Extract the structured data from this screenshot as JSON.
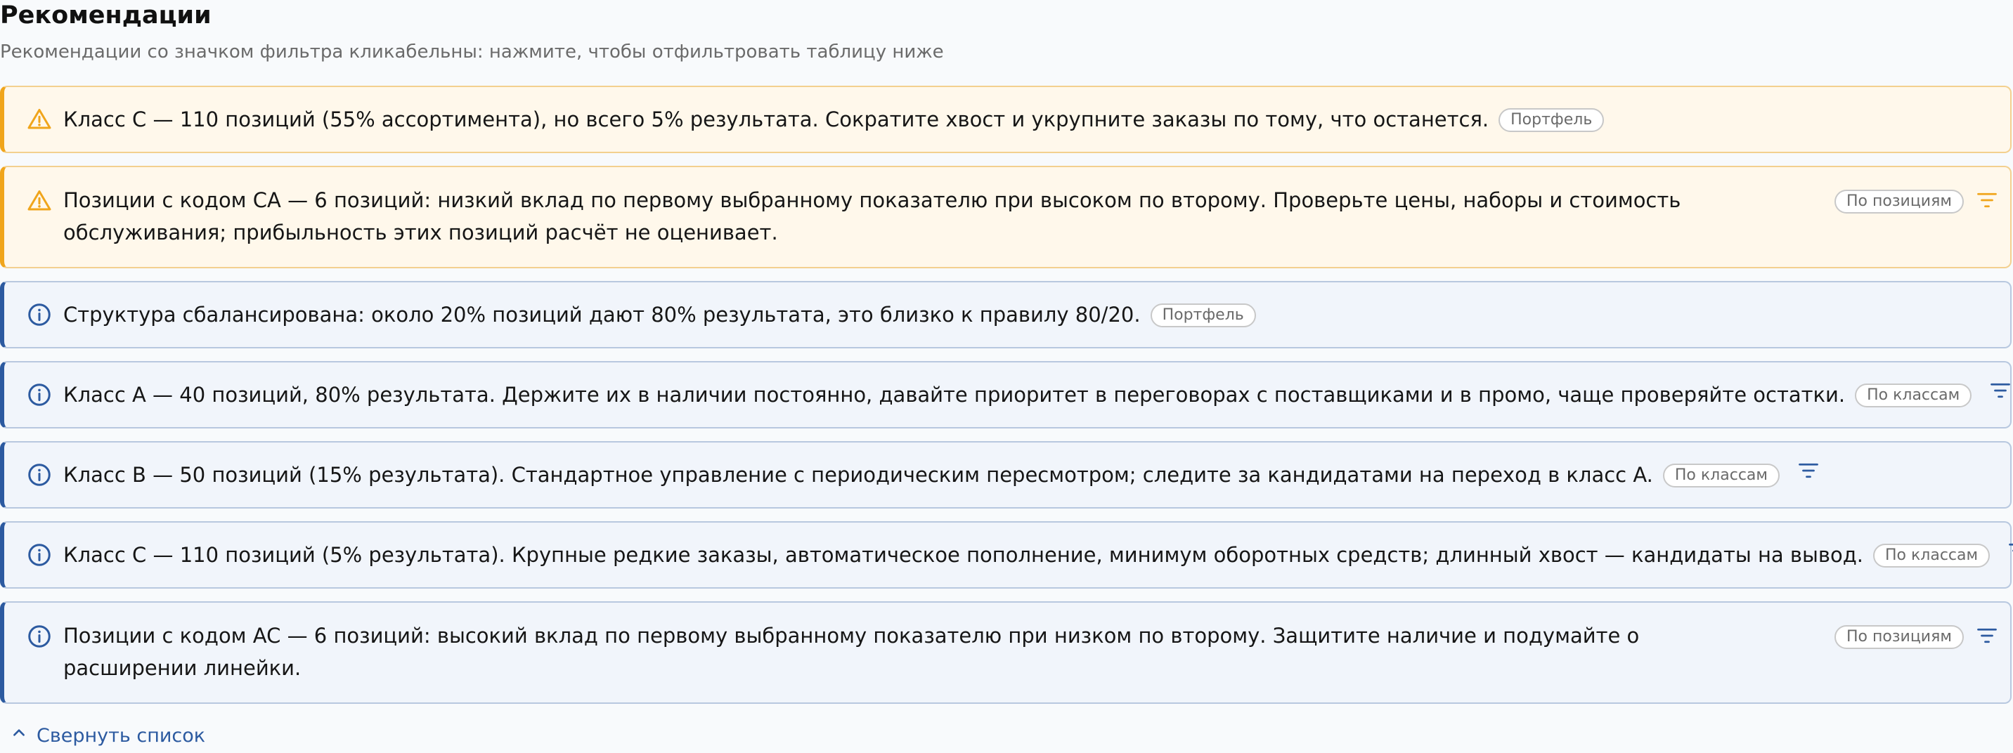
{
  "header": {
    "title": "Рекомендации",
    "subtitle": "Рекомендации со значком фильтра кликабельны: нажмите, чтобы отфильтровать таблицу ниже"
  },
  "recommendations": [
    {
      "type": "warning",
      "icon": "warning-triangle-icon",
      "text": "Класс C — 110 позиций (55% ассортимента), но всего 5% результата. Сократите хвост и укрупните заказы по тому, что останется.",
      "tag": "Портфель",
      "filterable": false
    },
    {
      "type": "warning",
      "icon": "warning-triangle-icon",
      "text": "Позиции с кодом CA — 6 позиций: низкий вклад по первому выбранному показателю при высоком по второму. Проверьте цены, наборы и стоимость обслуживания; прибыльность этих позиций расчёт не оценивает.",
      "tag": "По позициям",
      "filterable": true
    },
    {
      "type": "info",
      "icon": "info-circle-icon",
      "text": "Структура сбалансирована: около 20% позиций дают 80% результата, это близко к правилу 80/20.",
      "tag": "Портфель",
      "filterable": false
    },
    {
      "type": "info",
      "icon": "info-circle-icon",
      "text": "Класс A — 40 позиций, 80% результата. Держите их в наличии постоянно, давайте приоритет в переговорах с поставщиками и в промо, чаще проверяйте остатки.",
      "tag": "По классам",
      "filterable": true
    },
    {
      "type": "info",
      "icon": "info-circle-icon",
      "text": "Класс B — 50 позиций (15% результата). Стандартное управление с периодическим пересмотром; следите за кандидатами на переход в класс A.",
      "tag": "По классам",
      "filterable": true
    },
    {
      "type": "info",
      "icon": "info-circle-icon",
      "text": "Класс C — 110 позиций (5% результата). Крупные редкие заказы, автоматическое пополнение, минимум оборотных средств; длинный хвост — кандидаты на вывод.",
      "tag": "По классам",
      "filterable": true
    },
    {
      "type": "info",
      "icon": "info-circle-icon",
      "text": "Позиции с кодом AC — 6 позиций: высокий вклад по первому выбранному показателю при низком по второму. Защитите наличие и подумайте о расширении линейки.",
      "tag": "По позициям",
      "filterable": true
    }
  ],
  "footer": {
    "collapse_label": "Свернуть список",
    "collapse_icon": "chevron-up-icon"
  },
  "colors": {
    "warning_accent": "#f0a51b",
    "info_accent": "#2c5aa0",
    "link": "#2c5aa0"
  }
}
